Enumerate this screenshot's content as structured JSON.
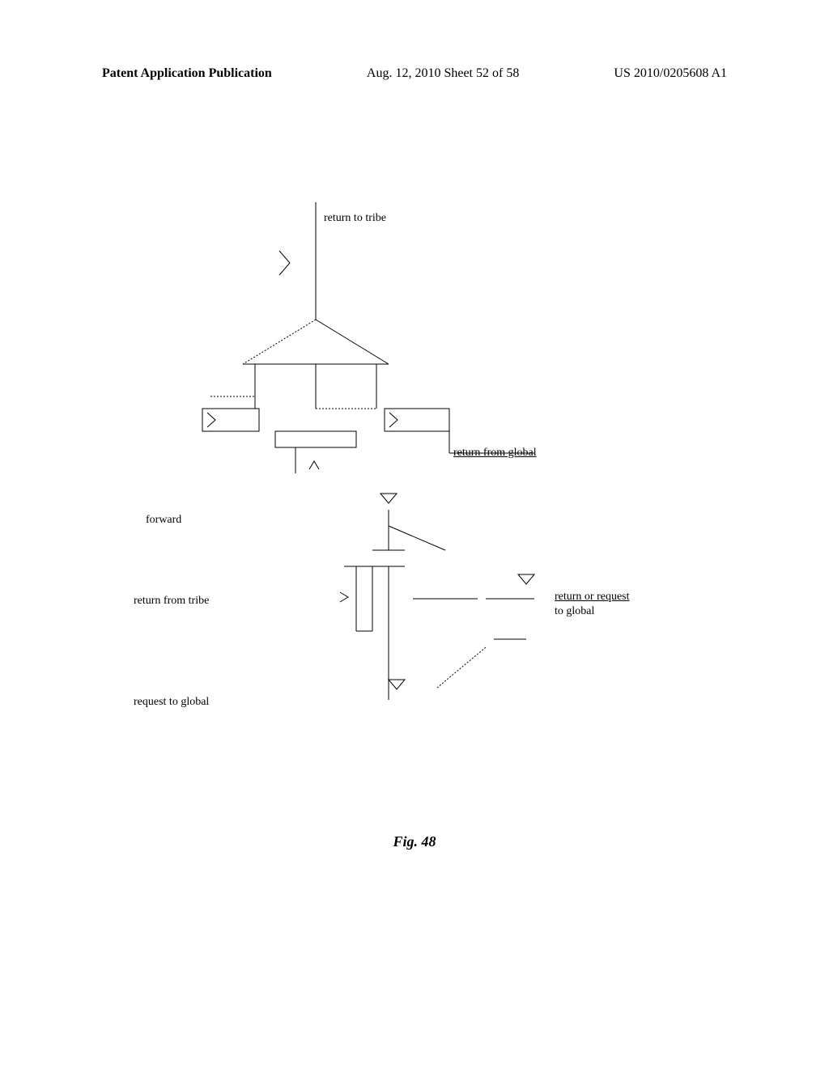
{
  "header": {
    "left": "Patent Application Publication",
    "center": "Aug. 12, 2010  Sheet 52 of 58",
    "right": "US 2010/0205608 A1"
  },
  "labels": {
    "return_to_tribe": "return to tribe",
    "return_from_global": "return from global",
    "forward": "forward",
    "return_from_tribe": "return from tribe",
    "return_or_request_to_global_line1": "return or request",
    "return_or_request_to_global_line2": "to global",
    "request_to_global": "request to global"
  },
  "caption": "Fig. 48"
}
